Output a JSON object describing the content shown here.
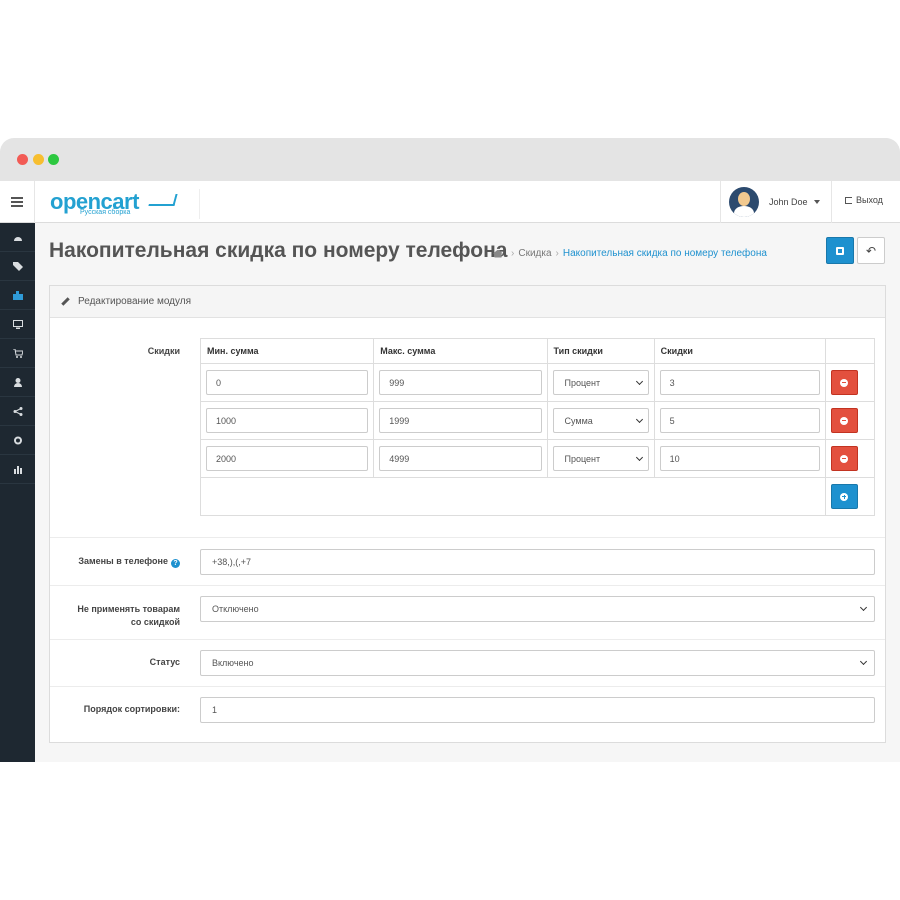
{
  "header": {
    "logo_main": "opencart",
    "logo_sub": "Русская сборка",
    "user_name": "John Doe",
    "logout_label": "Выход"
  },
  "sidebar": {
    "icons": [
      "dashboard-icon",
      "tags-icon",
      "puzzle-icon",
      "desktop-icon",
      "cart-icon",
      "user-icon",
      "share-icon",
      "cog-icon",
      "bar-chart-icon"
    ],
    "active_index": 2
  },
  "page": {
    "title": "Накопительная скидка по номеру телефона",
    "breadcrumb": [
      "Скидка",
      "Накопительная скидка по номеру телефона"
    ]
  },
  "panel": {
    "heading": "Редактирование модуля"
  },
  "discounts": {
    "label": "Скидки",
    "columns": [
      "Мин. сумма",
      "Макс. сумма",
      "Тип скидки",
      "Скидки"
    ],
    "rows": [
      {
        "min": "0",
        "max": "999",
        "type": "Процент",
        "value": "3"
      },
      {
        "min": "1000",
        "max": "1999",
        "type": "Сумма",
        "value": "5"
      },
      {
        "min": "2000",
        "max": "4999",
        "type": "Процент",
        "value": "10"
      }
    ]
  },
  "fields": {
    "phone_replace_label": "Замены в телефоне",
    "phone_replace_value": "+38,),(,+7",
    "exclude_label_line1": "Не применять товарам",
    "exclude_label_line2": "со скидкой",
    "exclude_value": "Отключено",
    "status_label": "Статус",
    "status_value": "Включено",
    "sort_label": "Порядок сортировки:",
    "sort_value": "1"
  },
  "colors": {
    "primary": "#1e91cf",
    "danger": "#e3503e",
    "sidebar": "#1e2831"
  }
}
